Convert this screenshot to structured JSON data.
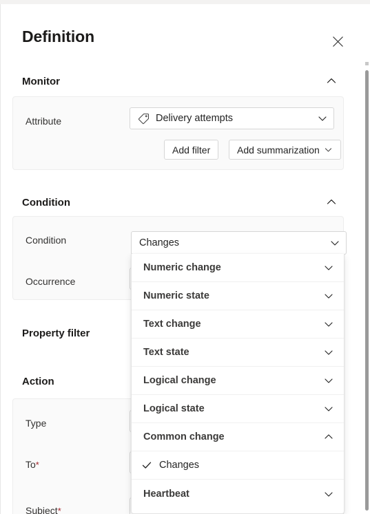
{
  "panel": {
    "title": "Definition",
    "close_icon": "close-icon"
  },
  "sections": {
    "monitor": {
      "heading": "Monitor",
      "collapse_icon": "chevron-up-icon",
      "attribute_label": "Attribute",
      "attribute_value": "Delivery attempts",
      "attribute_icon": "tag-icon",
      "attribute_chevron": "chevron-down-icon",
      "add_filter_label": "Add filter",
      "add_summarization_label": "Add summarization",
      "add_summarization_chevron": "chevron-down-icon"
    },
    "condition": {
      "heading": "Condition",
      "collapse_icon": "chevron-up-icon",
      "condition_label": "Condition",
      "condition_value": "Changes",
      "condition_chevron": "chevron-down-icon",
      "occurrence_label": "Occurrence"
    },
    "property_filter": {
      "heading": "Property filter"
    },
    "action": {
      "heading": "Action",
      "type_label": "Type",
      "to_label": "To",
      "to_required": "*",
      "subject_label": "Subject",
      "subject_required": "*"
    }
  },
  "dropdown": {
    "items": [
      {
        "label": "Numeric change",
        "type": "group",
        "icon": "chevron-down-icon",
        "checked": false
      },
      {
        "label": "Numeric state",
        "type": "group",
        "icon": "chevron-down-icon",
        "checked": false
      },
      {
        "label": "Text change",
        "type": "group",
        "icon": "chevron-down-icon",
        "checked": false
      },
      {
        "label": "Text state",
        "type": "group",
        "icon": "chevron-down-icon",
        "checked": false
      },
      {
        "label": "Logical change",
        "type": "group",
        "icon": "chevron-down-icon",
        "checked": false
      },
      {
        "label": "Logical state",
        "type": "group",
        "icon": "chevron-down-icon",
        "checked": false
      },
      {
        "label": "Common change",
        "type": "group",
        "icon": "chevron-up-icon",
        "checked": false
      },
      {
        "label": "Changes",
        "type": "option",
        "icon": "check-icon",
        "checked": true
      },
      {
        "label": "Heartbeat",
        "type": "group",
        "icon": "chevron-down-icon",
        "checked": false
      }
    ]
  },
  "colors": {
    "accent": "#0f6cbd",
    "required": "#a4262c",
    "card_bg": "#fafafa",
    "text": "#242424"
  }
}
